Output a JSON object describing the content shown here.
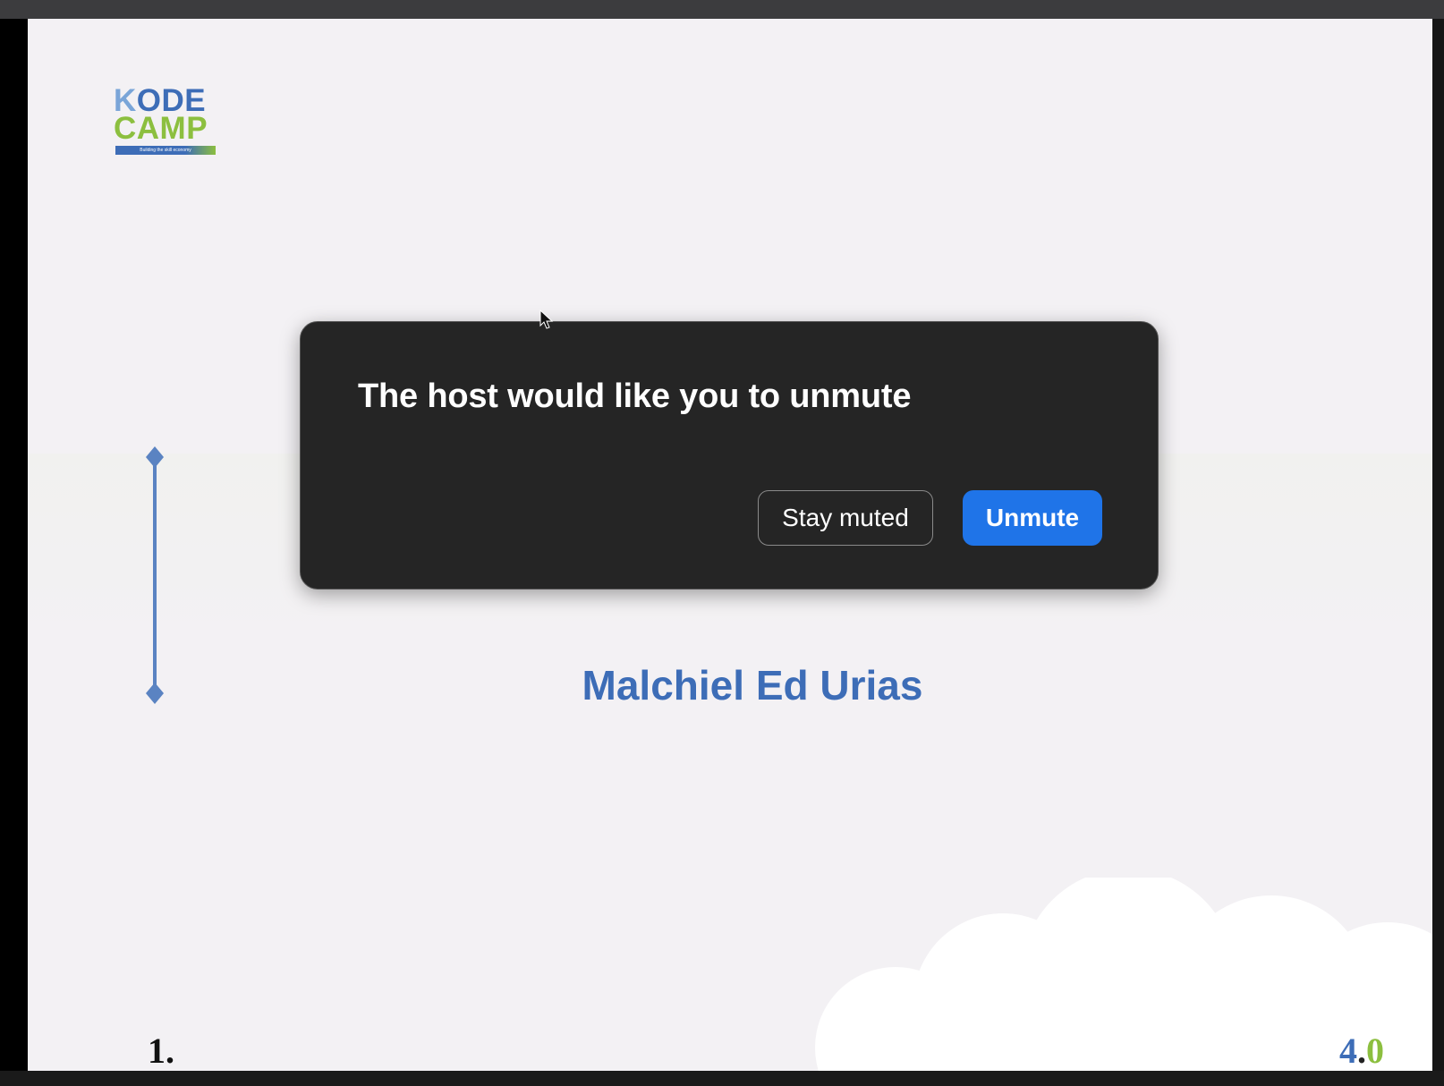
{
  "slide": {
    "logo": {
      "line1": "KODE",
      "line2": "CAMP",
      "tagline": "Building the skill economy"
    },
    "presenter_name": "Malchiel Ed Urias",
    "page_number": "1.",
    "version": {
      "major": "4",
      "dot": ".",
      "minor": "0"
    }
  },
  "dialog": {
    "title": "The host would like you to unmute",
    "stay_muted_label": "Stay muted",
    "unmute_label": "Unmute"
  },
  "colors": {
    "brand_blue": "#3d6db7",
    "brand_green": "#8cbf3f",
    "dialog_bg": "#252525",
    "primary_button": "#1f74e8"
  },
  "icons": {
    "cursor": "mouse-pointer-icon",
    "timeline": "timeline-diamond-line"
  }
}
